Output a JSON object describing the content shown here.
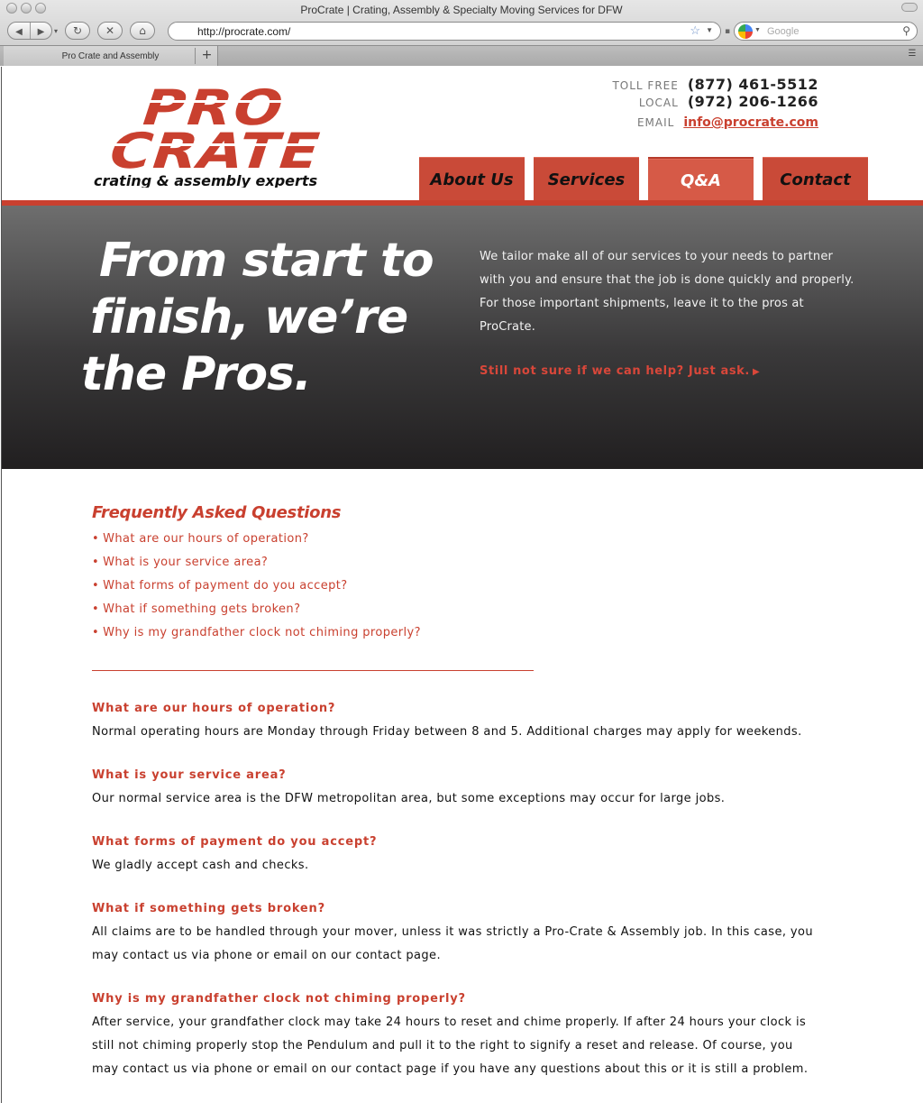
{
  "browser": {
    "window_title": "ProCrate | Crating, Assembly & Specialty Moving Services for DFW",
    "url": "http://procrate.com/",
    "search_placeholder": "Google",
    "tab_title": "Pro Crate and Assembly",
    "new_tab_label": "+",
    "icons": [
      "back-icon",
      "forward-icon",
      "reload-icon",
      "stop-icon",
      "home-icon",
      "bookmark-star-icon",
      "search-icon",
      "tab-menu-icon"
    ]
  },
  "logo": {
    "line1": "PRO",
    "line2": "CRATE",
    "tagline": "crating & assembly experts",
    "color": "#c9402f"
  },
  "contact": {
    "tollfree_label": "TOLL FREE",
    "tollfree_value": "(877) 461-5512",
    "local_label": "LOCAL",
    "local_value": "(972) 206-1266",
    "email_label": "EMAIL",
    "email_value": "info@procrate.com"
  },
  "nav": {
    "items": [
      {
        "label": "About Us"
      },
      {
        "label": "Services"
      },
      {
        "label": "Q&A",
        "active": true
      },
      {
        "label": "Contact"
      }
    ]
  },
  "hero": {
    "title_line1": "From start to",
    "title_line2": "finish, we’re",
    "title_line3": "the Pros.",
    "text": "We tailor make all of our services to your needs to partner with you and ensure that the job is done quickly and properly.  For those important shipments, leave it to the pros at ProCrate.",
    "cta": "Still not sure if we can help? Just ask.",
    "cta_arrow": "▶"
  },
  "faq": {
    "title": "Frequently Asked Questions",
    "bullet": "•",
    "questions": [
      "What are our hours of operation?",
      "What is your service area?",
      "What forms of payment do you accept?",
      "What if something gets broken?",
      "Why is my grandfather clock not chiming properly?"
    ],
    "answers": [
      "Normal operating hours are Monday through Friday between 8 and 5. Additional charges may apply for weekends.",
      "Our normal service area is the DFW metropolitan area, but some exceptions may occur for large jobs.",
      "We gladly accept cash and checks.",
      "All claims are to be handled through your mover, unless it was strictly a Pro-Crate & Assembly job. In this case, you may contact us via phone or email on our contact page.",
      "After service, your grandfather clock may take 24 hours to reset and chime properly. If after 24 hours your clock is still not chiming properly stop the Pendulum and pull it to the right to signify a reset and release. Of course, you may contact us via phone or email on our contact page if you have any questions about this or it is still a problem."
    ]
  }
}
